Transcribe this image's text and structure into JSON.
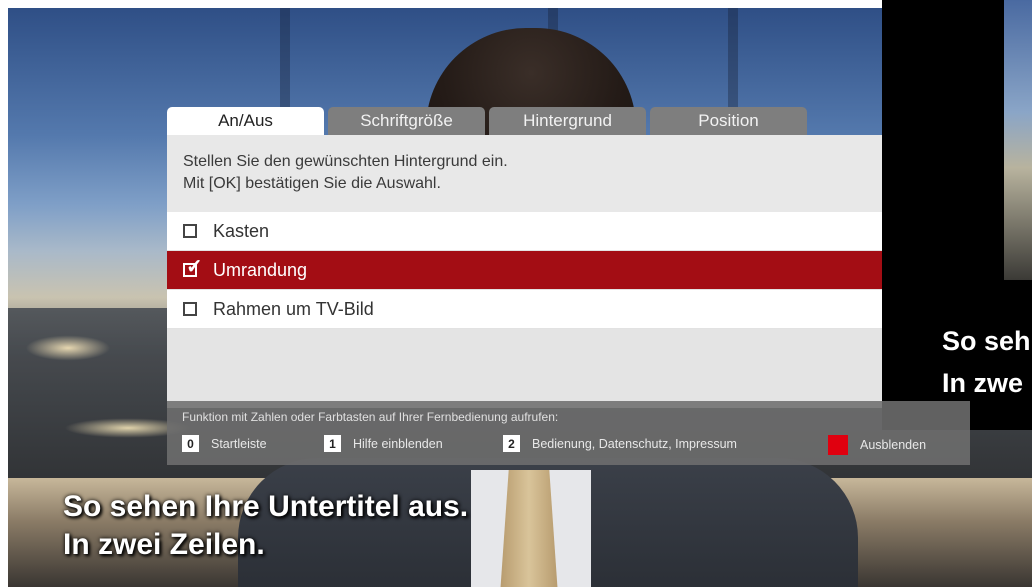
{
  "tv": {
    "subtitle_line1": "So sehen Ihre Untertitel aus.",
    "subtitle_line2": "In zwei Zeilen."
  },
  "preview": {
    "line1": "So seh",
    "line2": "In zwe"
  },
  "tabs": [
    {
      "label": "An/Aus",
      "active": true
    },
    {
      "label": "Schriftgröße",
      "active": false
    },
    {
      "label": "Hintergrund",
      "active": false
    },
    {
      "label": "Position",
      "active": false
    }
  ],
  "instruction": {
    "line1": "Stellen Sie den gewünschten Hintergrund ein.",
    "line2": "Mit [OK] bestätigen Sie die Auswahl."
  },
  "options": [
    {
      "label": "Kasten",
      "checked": false,
      "selected": false
    },
    {
      "label": "Umrandung",
      "checked": true,
      "selected": true
    },
    {
      "label": "Rahmen um TV-Bild",
      "checked": false,
      "selected": false
    }
  ],
  "footer": {
    "hint": "Funktion mit Zahlen oder Farbtasten auf Ihrer Fernbedienung aufrufen:",
    "keys": [
      {
        "key": "0",
        "label": "Startleiste"
      },
      {
        "key": "1",
        "label": "Hilfe einblenden"
      },
      {
        "key": "2",
        "label": "Bedienung, Datenschutz, Impressum"
      }
    ],
    "red_key_label": "Ausblenden",
    "red_key_icon": "red-square-icon"
  },
  "colors": {
    "selected_row": "#a30d14",
    "red_key": "#e0000f",
    "tab_inactive": "#7e7e7e"
  }
}
